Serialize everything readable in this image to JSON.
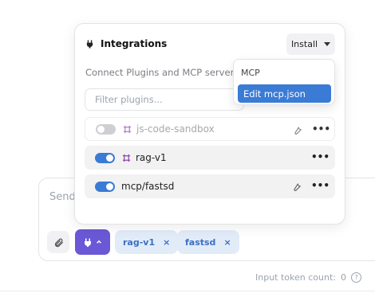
{
  "popover": {
    "title": "Integrations",
    "install_label": "Install",
    "description": "Connect Plugins and MCP servers to",
    "filter_placeholder": "Filter plugins...",
    "plugins": [
      {
        "label": "js-code-sandbox",
        "enabled": false,
        "has_settings": true,
        "type": "plugin"
      },
      {
        "label": "rag-v1",
        "enabled": true,
        "has_settings": false,
        "type": "plugin"
      },
      {
        "label": "mcp/fastsd",
        "enabled": true,
        "has_settings": true,
        "type": "mcp"
      }
    ],
    "more_label": "•••"
  },
  "install_menu": {
    "section_label": "MCP",
    "item_label": "Edit mcp.json"
  },
  "composer": {
    "placeholder": "Send",
    "chips": [
      {
        "label": "rag-v1",
        "remove": "×"
      },
      {
        "label": "fastsd",
        "remove": "×"
      }
    ]
  },
  "footer": {
    "token_label": "Input token count:",
    "token_value": "0",
    "help": "?"
  },
  "colors": {
    "accent": "#6a58d6",
    "toggle_on": "#3a7bd5",
    "chip_bg": "#e2ecf8",
    "chip_text": "#3b6fc4",
    "puzzle": "#8e44ad"
  },
  "icons": [
    "plug-icon",
    "paperclip-icon",
    "puzzle-icon",
    "wrench-icon",
    "more-icon",
    "chevron-down-icon",
    "close-icon",
    "help-icon"
  ]
}
